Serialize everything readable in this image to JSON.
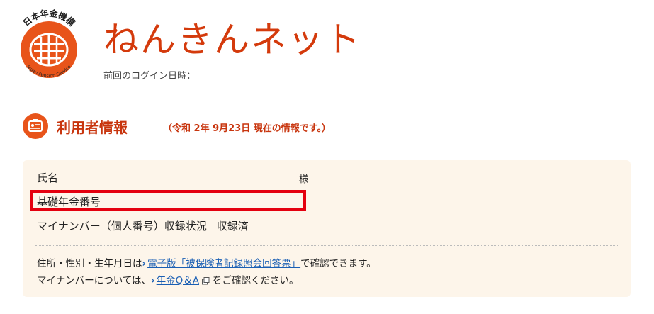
{
  "header": {
    "seal_text_top": "日本年金機構",
    "seal_text_bottom": "Japan Pension Service",
    "brand": "ねんきんネット",
    "last_login_label": "前回のログイン日時："
  },
  "section": {
    "title": "利用者情報",
    "note": "（令和 2年 9月23日 現在の情報です。）",
    "icon": "id-card-icon"
  },
  "info": {
    "name_label": "氏名",
    "name_suffix": "様",
    "basic_pension_label": "基礎年金番号",
    "mynumber_label": "マイナンバー（個人番号）収録状況",
    "mynumber_status": "収録済"
  },
  "notes": {
    "line1_pre": "住所・性別・生年月日は",
    "line1_link": "電子版「被保険者記録照会回答票」",
    "line1_post": "で確認できます。",
    "line2_pre": "マイナンバーについては、",
    "line2_link": "年金Q＆A",
    "line2_post": "をご確認ください。"
  },
  "colors": {
    "brand": "#d43a0c",
    "accent": "#e8541a",
    "highlight": "#e4000f",
    "box_bg": "#fdf5ea",
    "link": "#1a5fb4"
  }
}
